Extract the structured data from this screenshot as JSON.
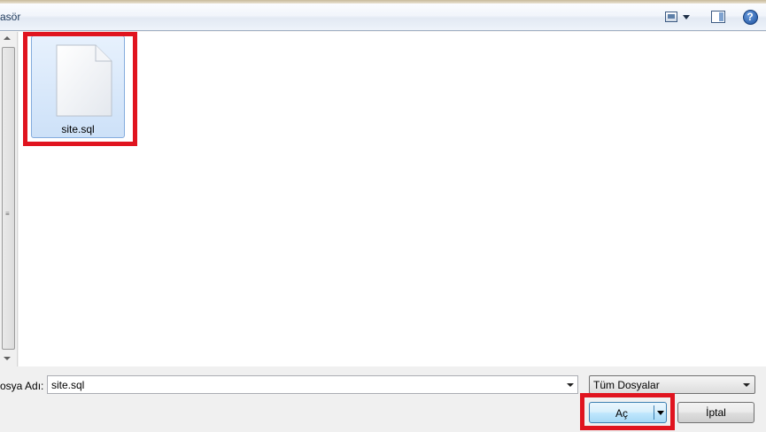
{
  "toolbar": {
    "breadcrumb_fragment": "asör",
    "icons": {
      "views": "change-view-icon",
      "views_dropdown": "chevron-down-icon",
      "preview": "preview-pane-icon",
      "help": "help-icon"
    },
    "help_glyph": "?"
  },
  "left_scrollbar": {
    "grip": "≡"
  },
  "files": [
    {
      "name": "site.sql",
      "icon": "document-icon",
      "selected": true
    }
  ],
  "bottom": {
    "filename_label": "osya Adı:",
    "filename_value": "site.sql",
    "filter_value": "Tüm Dosyalar",
    "open_label": "Aç",
    "cancel_label": "İptal"
  },
  "highlight_color": "#e0141f",
  "selection_color": "#cde1f8"
}
